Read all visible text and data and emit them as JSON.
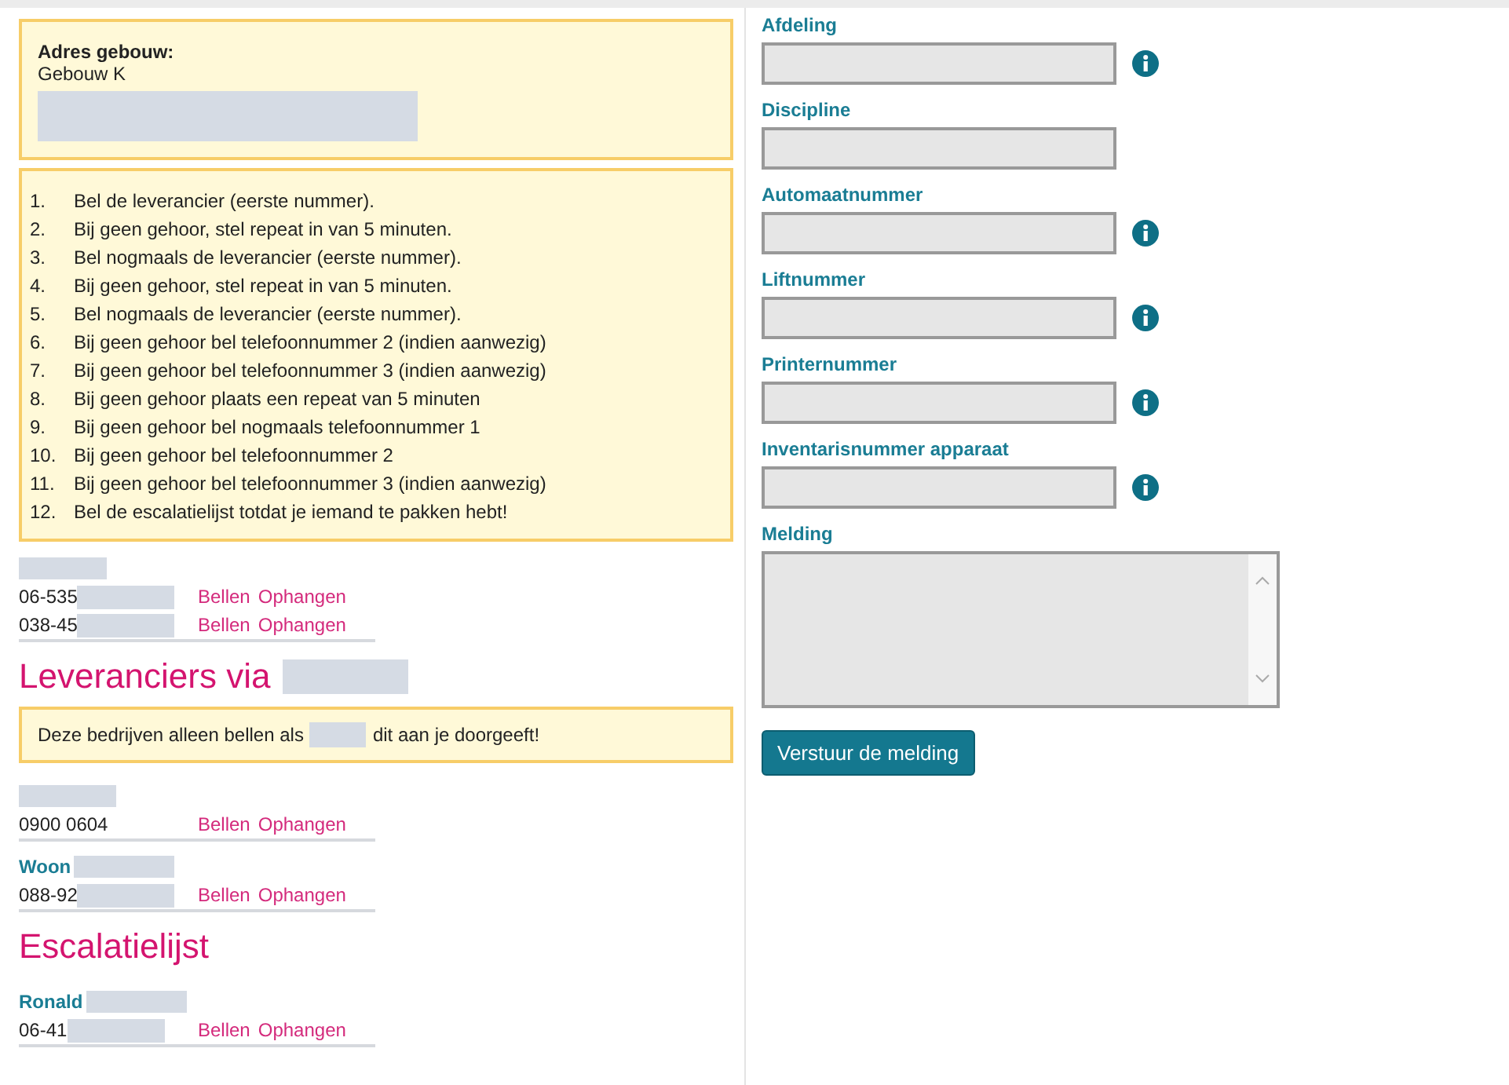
{
  "address": {
    "title": "Adres gebouw:",
    "line": "Gebouw K",
    "redacted": true
  },
  "steps": [
    {
      "number": "1.",
      "text": "Bel de leverancier (eerste nummer)."
    },
    {
      "number": "2.",
      "text": "Bij geen gehoor, stel repeat in van 5 minuten."
    },
    {
      "number": "3.",
      "text": "Bel nogmaals de leverancier (eerste nummer)."
    },
    {
      "number": "4.",
      "text": "Bij geen gehoor, stel repeat in van 5 minuten."
    },
    {
      "number": "5.",
      "text": "Bel nogmaals de leverancier (eerste nummer)."
    },
    {
      "number": "6.",
      "text": "Bij geen gehoor bel telefoonnummer 2 (indien aanwezig)"
    },
    {
      "number": "7.",
      "text": "Bij geen gehoor bel telefoonnummer 3 (indien aanwezig)"
    },
    {
      "number": "8.",
      "text": "Bij geen gehoor plaats een repeat van 5 minuten"
    },
    {
      "number": "9.",
      "text": "Bij geen gehoor bel nogmaals telefoonnummer 1"
    },
    {
      "number": "10.",
      "text": "Bij geen gehoor bel telefoonnummer 2"
    },
    {
      "number": "11.",
      "text": "Bij geen gehoor bel telefoonnummer 3 (indien aanwezig)"
    },
    {
      "number": "12.",
      "text": "Bel de escalatielijst totdat je iemand te pakken hebt!"
    }
  ],
  "sections": [
    {
      "kind": "contact",
      "name_redacted": true,
      "phones": [
        {
          "number": "06-535",
          "redacted": true,
          "actions": [
            "Bellen",
            "Ophangen"
          ]
        },
        {
          "number": "038-45",
          "redacted": true,
          "actions": [
            "Bellen",
            "Ophangen"
          ]
        }
      ]
    },
    {
      "kind": "heading",
      "text": "Leveranciers via",
      "redacted": true
    },
    {
      "kind": "notice",
      "before": "Deze bedrijven alleen bellen als",
      "after": "dit aan je doorgeeft!",
      "redacted": true
    },
    {
      "kind": "contact",
      "name_redacted": true,
      "phones": [
        {
          "number": "0900 0604",
          "redacted": false,
          "actions": [
            "Bellen",
            "Ophangen"
          ]
        }
      ]
    },
    {
      "kind": "contact",
      "name": "Woon",
      "name_redacted": true,
      "phones": [
        {
          "number": "088-92",
          "redacted": true,
          "actions": [
            "Bellen",
            "Ophangen"
          ]
        }
      ]
    },
    {
      "kind": "heading",
      "text": "Escalatielijst",
      "redacted": false
    },
    {
      "kind": "contact",
      "name": "Ronald",
      "name_redacted": true,
      "phones": [
        {
          "number": "06-41",
          "redacted": true,
          "actions": [
            "Bellen",
            "Ophangen"
          ]
        }
      ]
    }
  ],
  "form": {
    "fields": [
      {
        "kind": "input",
        "label": "Afdeling",
        "info": true
      },
      {
        "kind": "input",
        "label": "Discipline",
        "info": false
      },
      {
        "kind": "input",
        "label": "Automaatnummer",
        "info": true
      },
      {
        "kind": "input",
        "label": "Liftnummer",
        "info": true
      },
      {
        "kind": "input",
        "label": "Printernummer",
        "info": true
      },
      {
        "kind": "input",
        "label": "Inventarisnummer apparaat",
        "info": true
      },
      {
        "kind": "textarea",
        "label": "Melding",
        "info": false
      }
    ],
    "submit": "Verstuur de melding"
  }
}
